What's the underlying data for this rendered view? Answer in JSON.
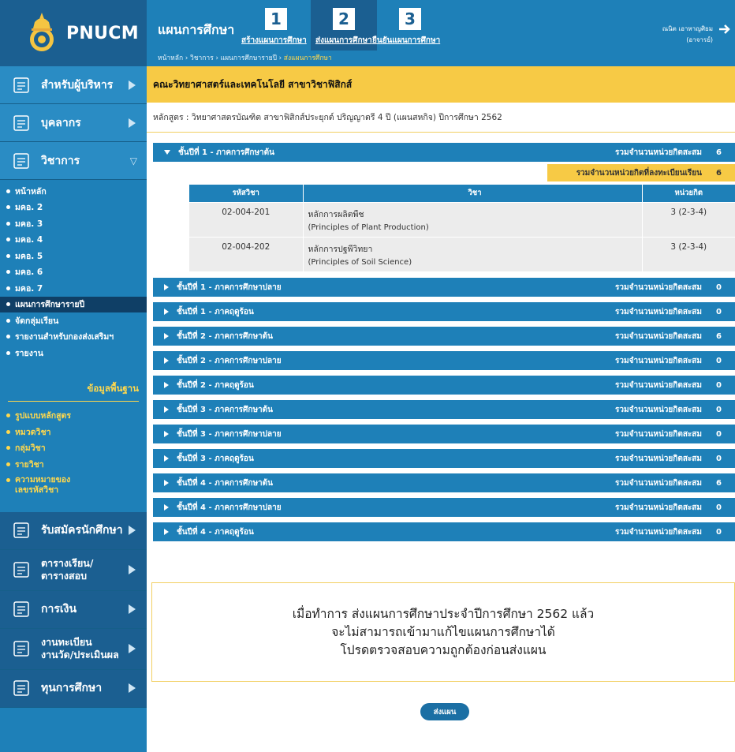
{
  "brand": {
    "logo_text": "PNUCM"
  },
  "topbar": {
    "title": "แผนการศึกษา",
    "steps": [
      {
        "num": "1",
        "label": "สร้างแผนการศึกษา"
      },
      {
        "num": "2",
        "label": "ส่งแผนการศึกษา"
      },
      {
        "num": "3",
        "label": "ยืนยันแผนการศึกษา"
      }
    ],
    "breadcrumb": {
      "items": [
        "หน้าหลัก",
        "วิชาการ",
        "แผนการศึกษารายปี"
      ],
      "separator": " › ",
      "current": "ส่งแผนการศึกษา"
    },
    "user": {
      "name": "ณนิต เอาหาญศิยม",
      "role": "(อาจารย์)"
    }
  },
  "sidebar": {
    "sections_top": [
      {
        "label": "สำหรับผู้บริหาร",
        "icon": "building-icon"
      },
      {
        "label": "บุคลากร",
        "icon": "person-icon"
      },
      {
        "label": "วิชาการ",
        "icon": "book-icon"
      }
    ],
    "academic_items": [
      {
        "label": "หน้าหลัก"
      },
      {
        "label": "มคอ. 2"
      },
      {
        "label": "มคอ. 3"
      },
      {
        "label": "มคอ. 4"
      },
      {
        "label": "มคอ. 5"
      },
      {
        "label": "มคอ. 6"
      },
      {
        "label": "มคอ. 7"
      },
      {
        "label": "แผนการศึกษารายปี"
      },
      {
        "label": "จัดกลุ่มเรียน"
      },
      {
        "label": "รายงานสำหรับกองส่งเสริมฯ"
      },
      {
        "label": "รายงาน"
      }
    ],
    "basic_data_title": "ข้อมูลพื้นฐาน",
    "basic_items": [
      {
        "label": "รูปแบบหลักสูตร"
      },
      {
        "label": "หมวดวิชา"
      },
      {
        "label": "กลุ่มวิชา"
      },
      {
        "label": "รายวิชา"
      },
      {
        "label": "ความหมายของ",
        "label2": "เลขรหัสวิชา"
      }
    ],
    "sections_bottom": [
      {
        "label": "รับสมัครนักศึกษา",
        "icon": "register-icon"
      },
      {
        "label": "ตารางเรียน/",
        "label2": "ตารางสอบ",
        "icon": "calendar-icon"
      },
      {
        "label": "การเงิน",
        "icon": "money-icon"
      },
      {
        "label": "งานทะเบียน",
        "label2": "งานวัด/ประเมินผล",
        "icon": "registry-icon"
      },
      {
        "label": "ทุนการศึกษา",
        "icon": "scholarship-icon"
      }
    ]
  },
  "main": {
    "faculty": "คณะวิทยาศาสตร์และเทคโนโลยี สาขาวิชาฟิสิกส์",
    "program": "หลักสูตร : วิทยาศาสตรบัณฑิต สาขาฟิสิกส์ประยุกต์ ปริญญาตรี 4 ปี (แผนสหกิจ) ปีการศึกษา 2562",
    "sum_label": "รวมจำนวนหน่วยกิตสะสม",
    "reg_label": "รวมจำนวนหน่วยกิตที่ลงทะเบียนเรียน",
    "reg_value": "6",
    "table_headers": {
      "code": "รหัสวิชา",
      "name": "วิชา",
      "unit": "หน่วยกิต"
    },
    "courses": [
      {
        "code": "02-004-201",
        "name_th": "หลักการผลิตพืช",
        "name_en": "(Principles of Plant Production)",
        "unit": "3 (2-3-4)"
      },
      {
        "code": "02-004-202",
        "name_th": "หลักการปฐพีวิทยา",
        "name_en": "(Principles of Soil Science)",
        "unit": "3 (2-3-4)"
      }
    ],
    "semesters": [
      {
        "name": "ชั้นปีที่ 1 - ภาคการศึกษาต้น",
        "sum": "6",
        "expanded": true
      },
      {
        "name": "ชั้นปีที่ 1 - ภาคการศึกษาปลาย",
        "sum": "0"
      },
      {
        "name": "ชั้นปีที่ 1 - ภาคฤดูร้อน",
        "sum": "0"
      },
      {
        "name": "ชั้นปีที่ 2 - ภาคการศึกษาต้น",
        "sum": "6"
      },
      {
        "name": "ชั้นปีที่ 2 - ภาคการศึกษาปลาย",
        "sum": "0"
      },
      {
        "name": "ชั้นปีที่ 2 - ภาคฤดูร้อน",
        "sum": "0"
      },
      {
        "name": "ชั้นปีที่ 3 - ภาคการศึกษาต้น",
        "sum": "0"
      },
      {
        "name": "ชั้นปีที่ 3 - ภาคการศึกษาปลาย",
        "sum": "0"
      },
      {
        "name": "ชั้นปีที่ 3 - ภาคฤดูร้อน",
        "sum": "0"
      },
      {
        "name": "ชั้นปีที่ 4 - ภาคการศึกษาต้น",
        "sum": "6"
      },
      {
        "name": "ชั้นปีที่ 4 - ภาคการศึกษาปลาย",
        "sum": "0"
      },
      {
        "name": "ชั้นปีที่ 4 - ภาคฤดูร้อน",
        "sum": "0"
      }
    ],
    "notice": [
      "เมื่อทำการ ส่งแผนการศึกษาประจำปีการศึกษา 2562 แล้ว",
      "จะไม่สามารถเข้ามาแก้ไขแผนการศึกษาได้",
      "โปรดตรวจสอบความถูกต้องก่อนส่งแผน"
    ],
    "submit_label": "ส่งแผน"
  },
  "colors": {
    "primary": "#1e80b8",
    "primary_dark": "#1b5f91",
    "accent_yellow": "#f7ca45"
  }
}
